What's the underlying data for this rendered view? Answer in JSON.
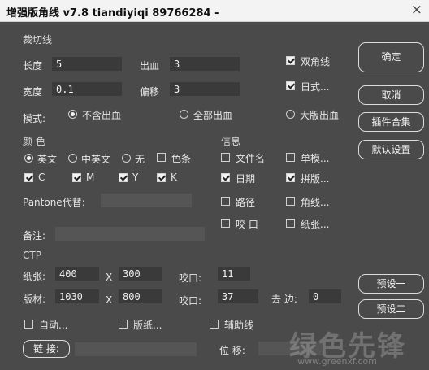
{
  "window": {
    "title": "增强版角线 v7.8 tiandiyiqi 89766284 -",
    "close_glyph": "×"
  },
  "cut": {
    "section": "裁切线",
    "length_label": "长度",
    "length_value": "5",
    "bleed_label": "出血",
    "bleed_value": "3",
    "width_label": "宽度",
    "width_value": "0.1",
    "offset_label": "偏移",
    "offset_value": "3",
    "double_corner": "双角线",
    "japanese": "日式...",
    "mode_label": "模式:",
    "mode_options": [
      "不含出血",
      "全部出血",
      "大版出血"
    ]
  },
  "color": {
    "section": "颜 色",
    "lang_options": [
      "英文",
      "中英文",
      "无"
    ],
    "color_strip": "色条",
    "channels": [
      "C",
      "M",
      "Y",
      "K"
    ],
    "pantone_label": "Pantone代替:"
  },
  "info": {
    "section": "信息",
    "items": [
      "文件名",
      "单模...",
      "日期",
      "拼版...",
      "路径",
      "角线...",
      "咬 口",
      "纸张..."
    ]
  },
  "note_label": "备注:",
  "ctp": {
    "section": "CTP",
    "paper_label": "纸张:",
    "paper_w": "400",
    "x1": "X",
    "paper_h": "300",
    "grip_label": "咬口:",
    "grip_value": "11",
    "plate_label": "版材:",
    "plate_w": "1030",
    "x2": "X",
    "plate_h": "800",
    "grip2_label": "咬口:",
    "grip2_value": "37",
    "trim_label": "去 边:",
    "trim_value": "0"
  },
  "bottom": {
    "auto": "自动...",
    "plate_paper": "版纸...",
    "guide": "辅助线",
    "link": "链 接:",
    "move_label": "位 移:"
  },
  "buttons": {
    "ok": "确定",
    "cancel": "取消",
    "plugins": "插件合集",
    "defaults": "默认设置",
    "preset1": "预设一",
    "preset2": "预设二"
  },
  "watermark": {
    "text": "绿色先锋",
    "url": "www.greenxf.com"
  }
}
